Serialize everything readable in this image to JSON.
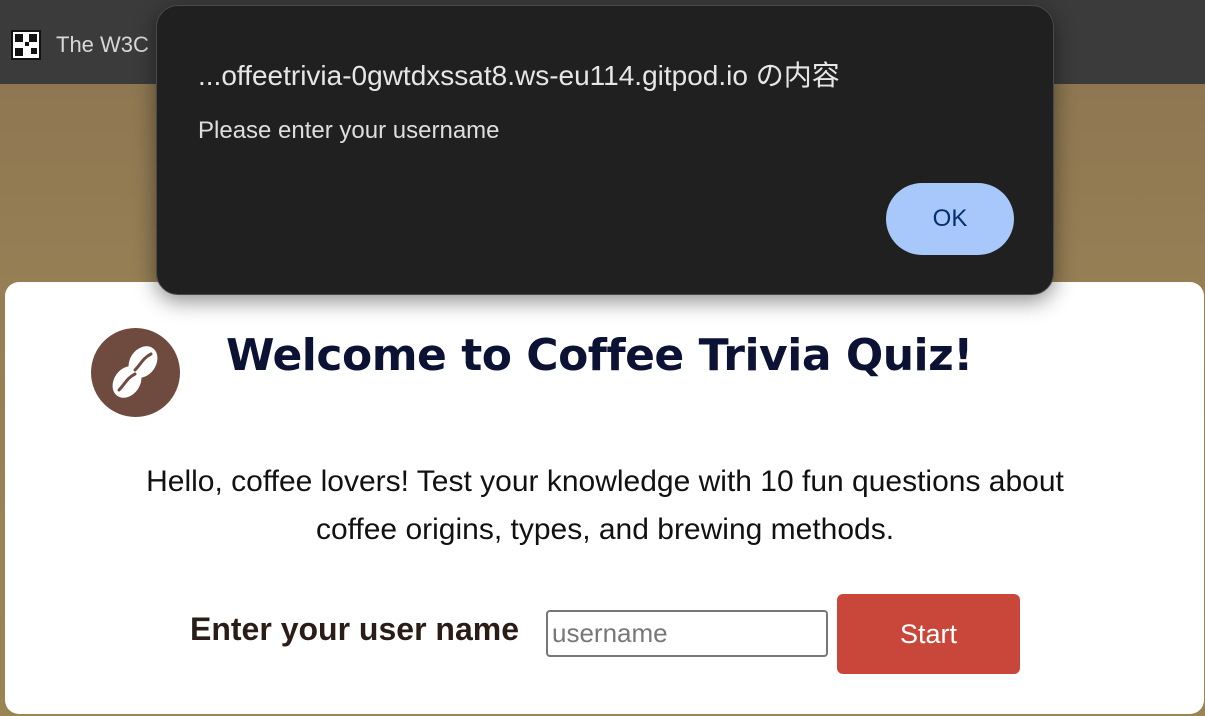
{
  "browser": {
    "tab_title": "The W3C",
    "favicon": "qr-like-favicon"
  },
  "dialog": {
    "origin": "...offeetrivia-0gwtdxssat8.ws-eu114.gitpod.io の内容",
    "message": "Please enter your username",
    "ok_label": "OK",
    "button_color": "#a8c7fa"
  },
  "page": {
    "logo_icon": "coffee-bean-icon",
    "title": "Welcome to Coffee Trivia Quiz!",
    "intro_line1": "Hello, coffee lovers! Test your knowledge with 10 fun questions about",
    "intro_line2": "coffee origins, types, and brewing methods.",
    "name_label": "Enter your user name",
    "name_placeholder": "username",
    "name_value": "",
    "start_label": "Start",
    "accent_color": "#c9473a",
    "logo_color": "#6f4a3e",
    "background_color": "#8c7752"
  }
}
